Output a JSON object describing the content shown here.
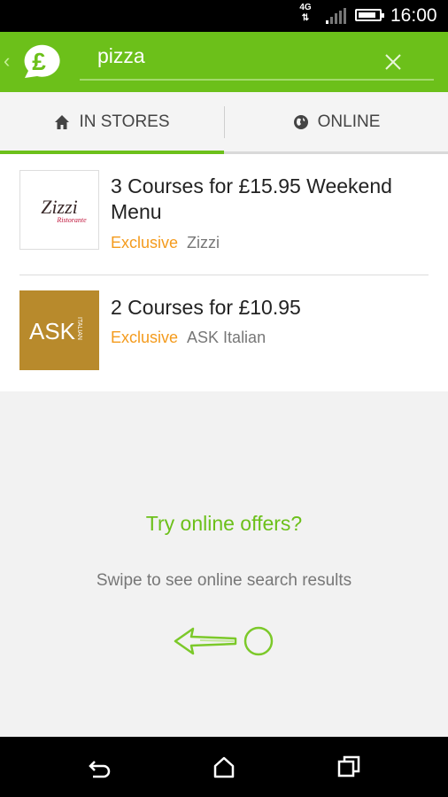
{
  "status_bar": {
    "network": "4G",
    "time": "16:00",
    "battery_level": 0.85
  },
  "search": {
    "query": "pizza"
  },
  "tabs": [
    {
      "label": "IN STORES",
      "icon": "home-icon",
      "selected": true
    },
    {
      "label": "ONLINE",
      "icon": "globe-icon",
      "selected": false
    }
  ],
  "results": [
    {
      "title": "3 Courses for £15.95 Weekend Menu",
      "badge": "Exclusive",
      "merchant": "Zizzi",
      "logo_text": "Zizzi",
      "logo_subtext": "Ristorante"
    },
    {
      "title": "2 Courses for £10.95",
      "badge": "Exclusive",
      "merchant": "ASK Italian",
      "logo_text": "ASK",
      "logo_subtext": "ITALIAN"
    }
  ],
  "empty_prompt": {
    "title": "Try online offers?",
    "subtitle": "Swipe to see online search results"
  },
  "colors": {
    "brand_green": "#6cc01a",
    "exclusive_orange": "#f49b1d",
    "ask_gold": "#b88a2c",
    "zizzi_red": "#c0163c"
  },
  "nav_bar": {
    "buttons": [
      "back-icon",
      "home-icon",
      "recent-apps-icon"
    ]
  }
}
